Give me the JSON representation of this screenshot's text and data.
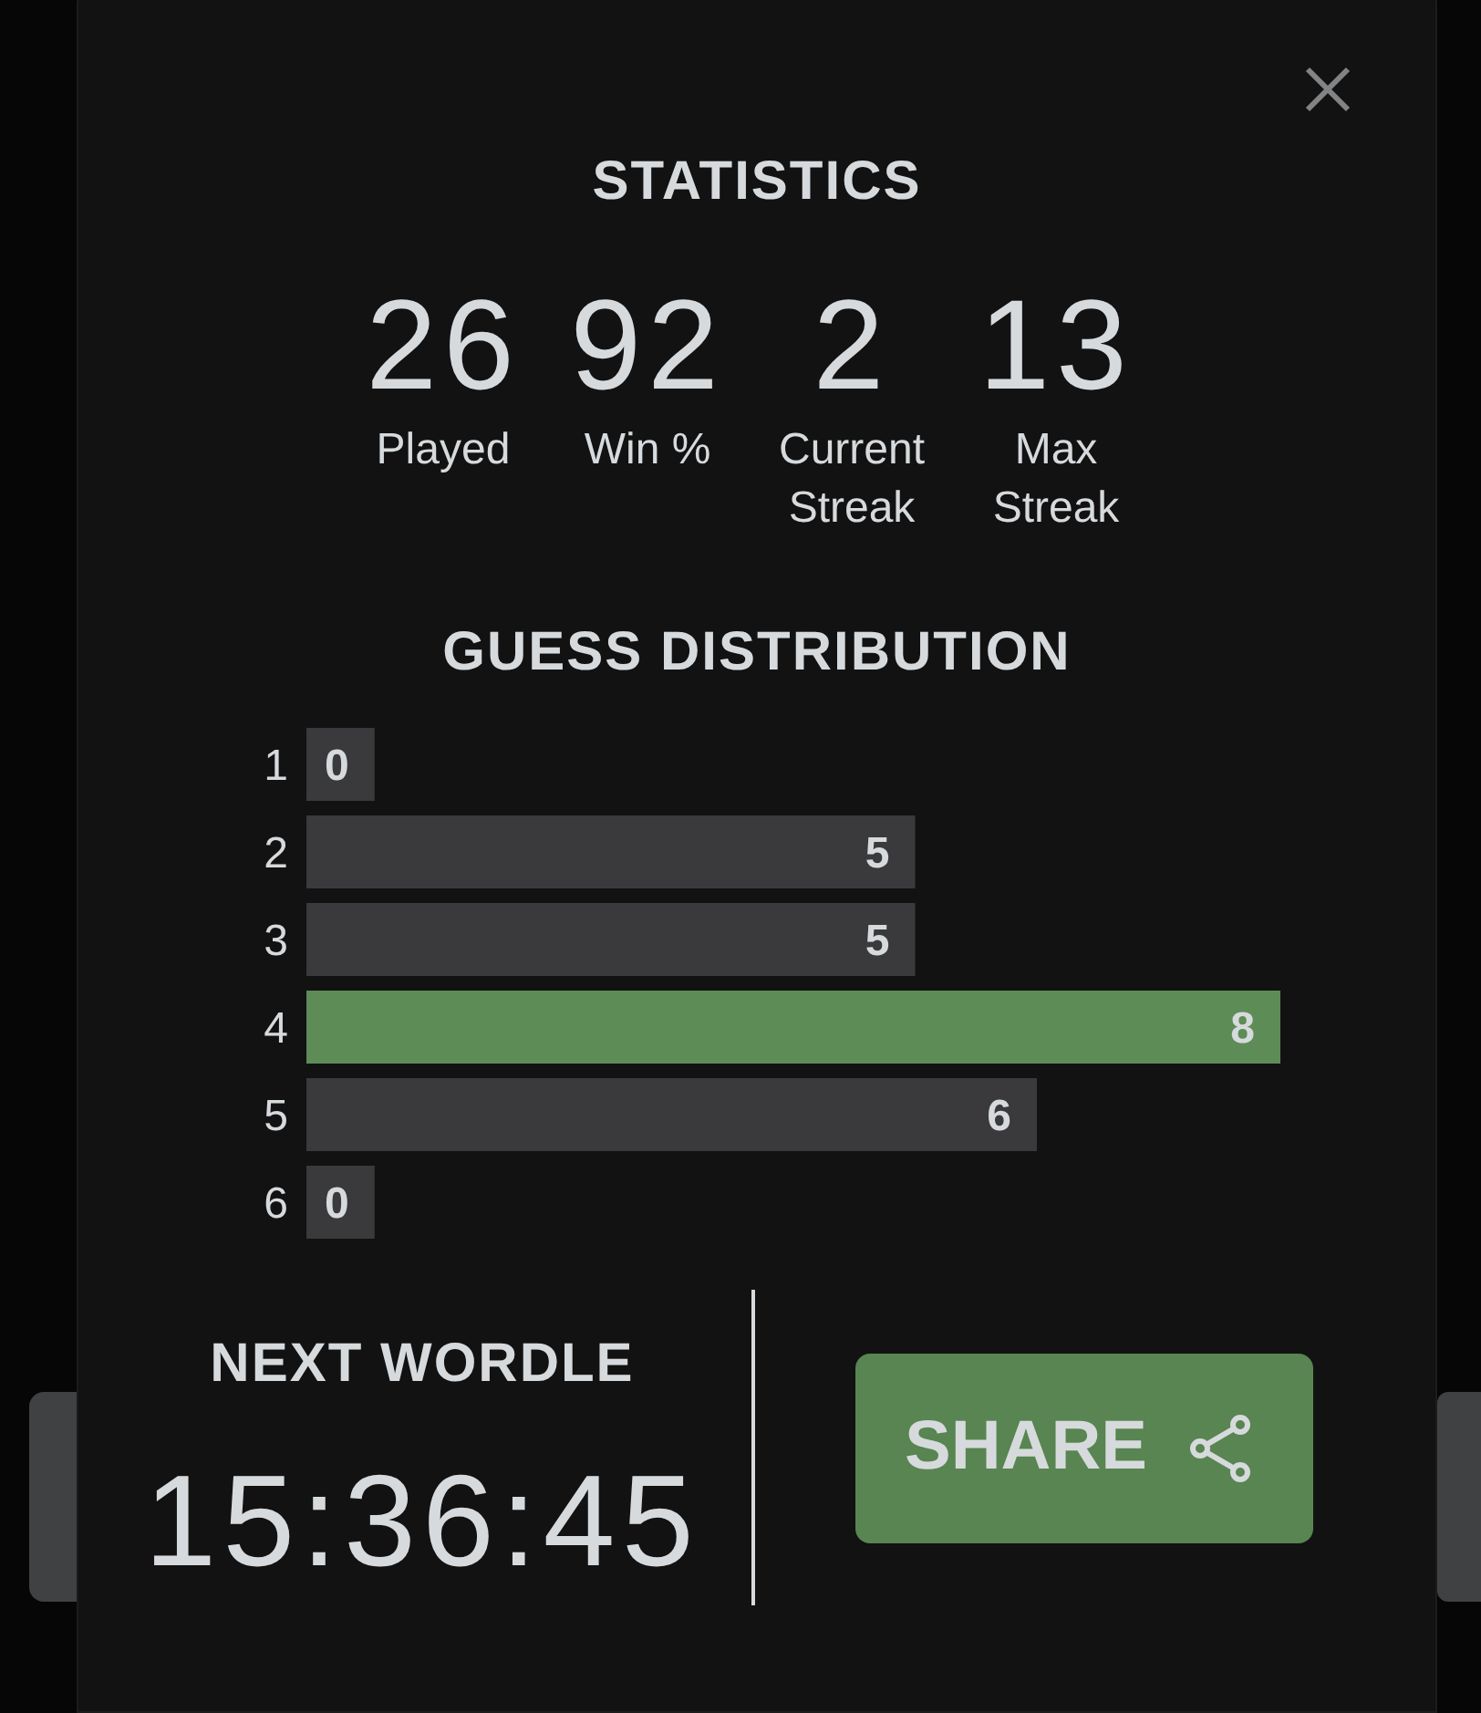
{
  "dialog": {
    "title": "STATISTICS"
  },
  "statistics": [
    {
      "value": "26",
      "label": "Played"
    },
    {
      "value": "92",
      "label": "Win %"
    },
    {
      "value": "2",
      "label": "Current Streak"
    },
    {
      "value": "13",
      "label": "Max Streak"
    }
  ],
  "distribution": {
    "title": "GUESS DISTRIBUTION",
    "chart_data": {
      "type": "bar",
      "orientation": "horizontal",
      "stacked": true,
      "categories": [
        "1",
        "2",
        "3",
        "4",
        "5",
        "6"
      ],
      "series": [
        {
          "color": "#3a3a3c",
          "values": [
            0,
            5,
            5,
            null,
            6,
            0
          ]
        },
        {
          "color": "#5e8c56",
          "values": [
            null,
            null,
            null,
            8,
            null,
            null
          ]
        }
      ],
      "data_labels": true
    }
  },
  "countdown": {
    "title": "NEXT WORDLE",
    "time": "15:36:45"
  },
  "share_button": {
    "label": "SHARE"
  }
}
